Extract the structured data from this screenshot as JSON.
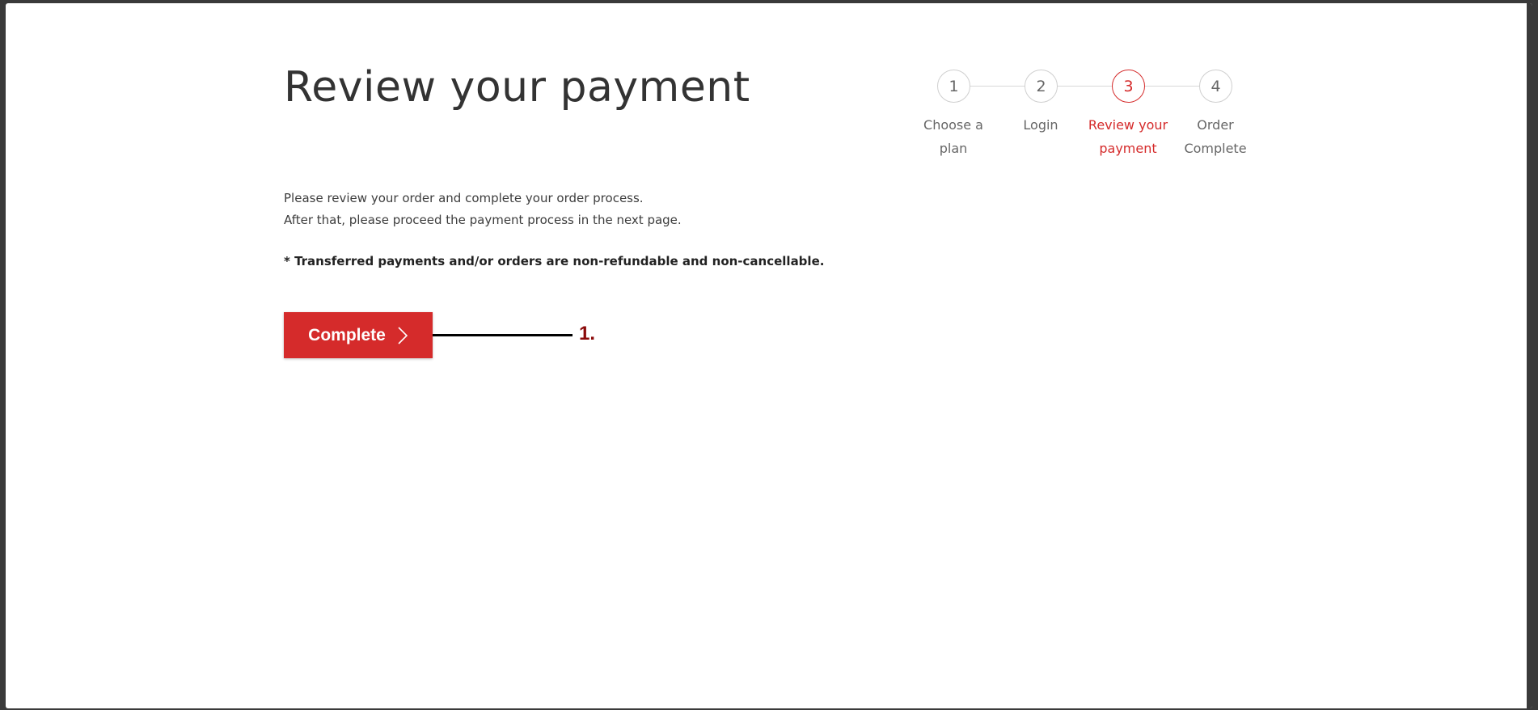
{
  "page": {
    "title": "Review your payment"
  },
  "intro": {
    "line1": "Please review your order and complete your order process.",
    "line2": "After that, please proceed the payment process in the next page."
  },
  "notice": "* Transferred payments and/or orders are non-refundable and non-cancellable.",
  "actions": {
    "complete_label": "Complete"
  },
  "callout": {
    "label": "1."
  },
  "stepper": {
    "steps": [
      {
        "number": "1",
        "line1": "Choose a",
        "line2": "plan",
        "active": false
      },
      {
        "number": "2",
        "line1": "Login",
        "line2": "",
        "active": false
      },
      {
        "number": "3",
        "line1": "Review your",
        "line2": "payment",
        "active": true
      },
      {
        "number": "4",
        "line1": "Order",
        "line2": "Complete",
        "active": false
      }
    ]
  },
  "colors": {
    "accent": "#d52b2b",
    "callout_text": "#8b0a0a",
    "text": "#333333",
    "inactive_step": "#666666"
  }
}
